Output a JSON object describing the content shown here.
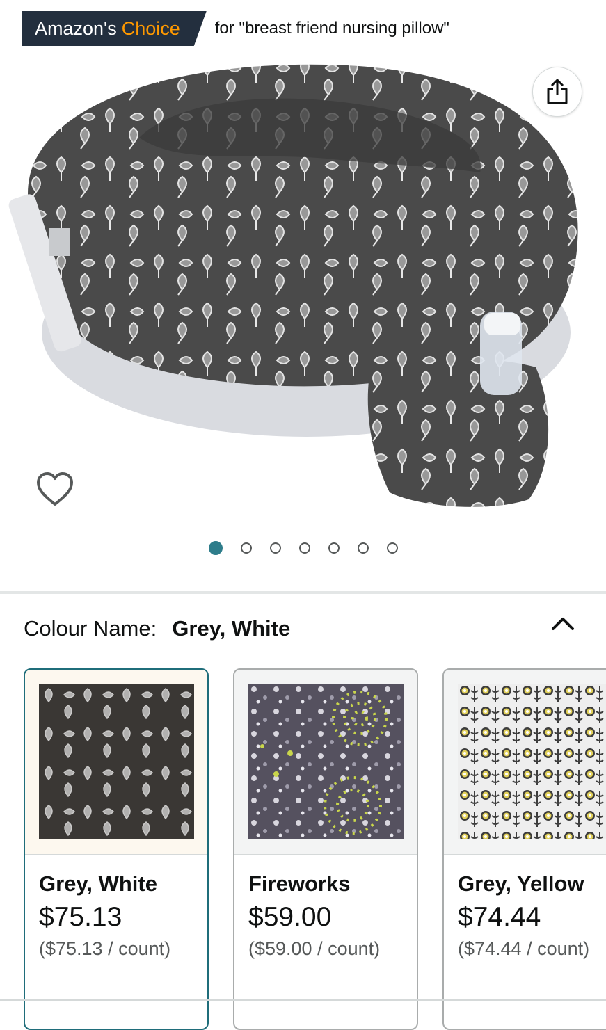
{
  "badge": {
    "amazons": "Amazon's",
    "choice": "Choice",
    "for_text": "for \"breast friend nursing pillow\""
  },
  "product_image": {
    "alt": "My Brest Friend nursing pillow, grey with white ginkgo leaf print, with water bottle in side pocket"
  },
  "icons": {
    "share": "share-icon",
    "wishlist": "heart-icon",
    "collapse": "chevron-up-icon"
  },
  "carousel": {
    "total": 7,
    "active_index": 0
  },
  "colour": {
    "label": "Colour Name:",
    "selected": "Grey, White"
  },
  "variants": [
    {
      "name": "Grey, White",
      "price": "$75.13",
      "unit_price": "($75.13 / count)",
      "selected": true,
      "pattern": "ginkgo"
    },
    {
      "name": "Fireworks",
      "price": "$59.00",
      "unit_price": "($59.00 / count)",
      "selected": false,
      "pattern": "fireworks"
    },
    {
      "name": "Grey, Yellow",
      "price": "$74.44",
      "unit_price": "($74.44 / count)",
      "selected": false,
      "pattern": "flowers"
    }
  ],
  "colors": {
    "badge_bg": "#232f3e",
    "choice": "#ff9900",
    "selected_border": "#1f6d7a",
    "active_dot": "#2e7d8b"
  }
}
